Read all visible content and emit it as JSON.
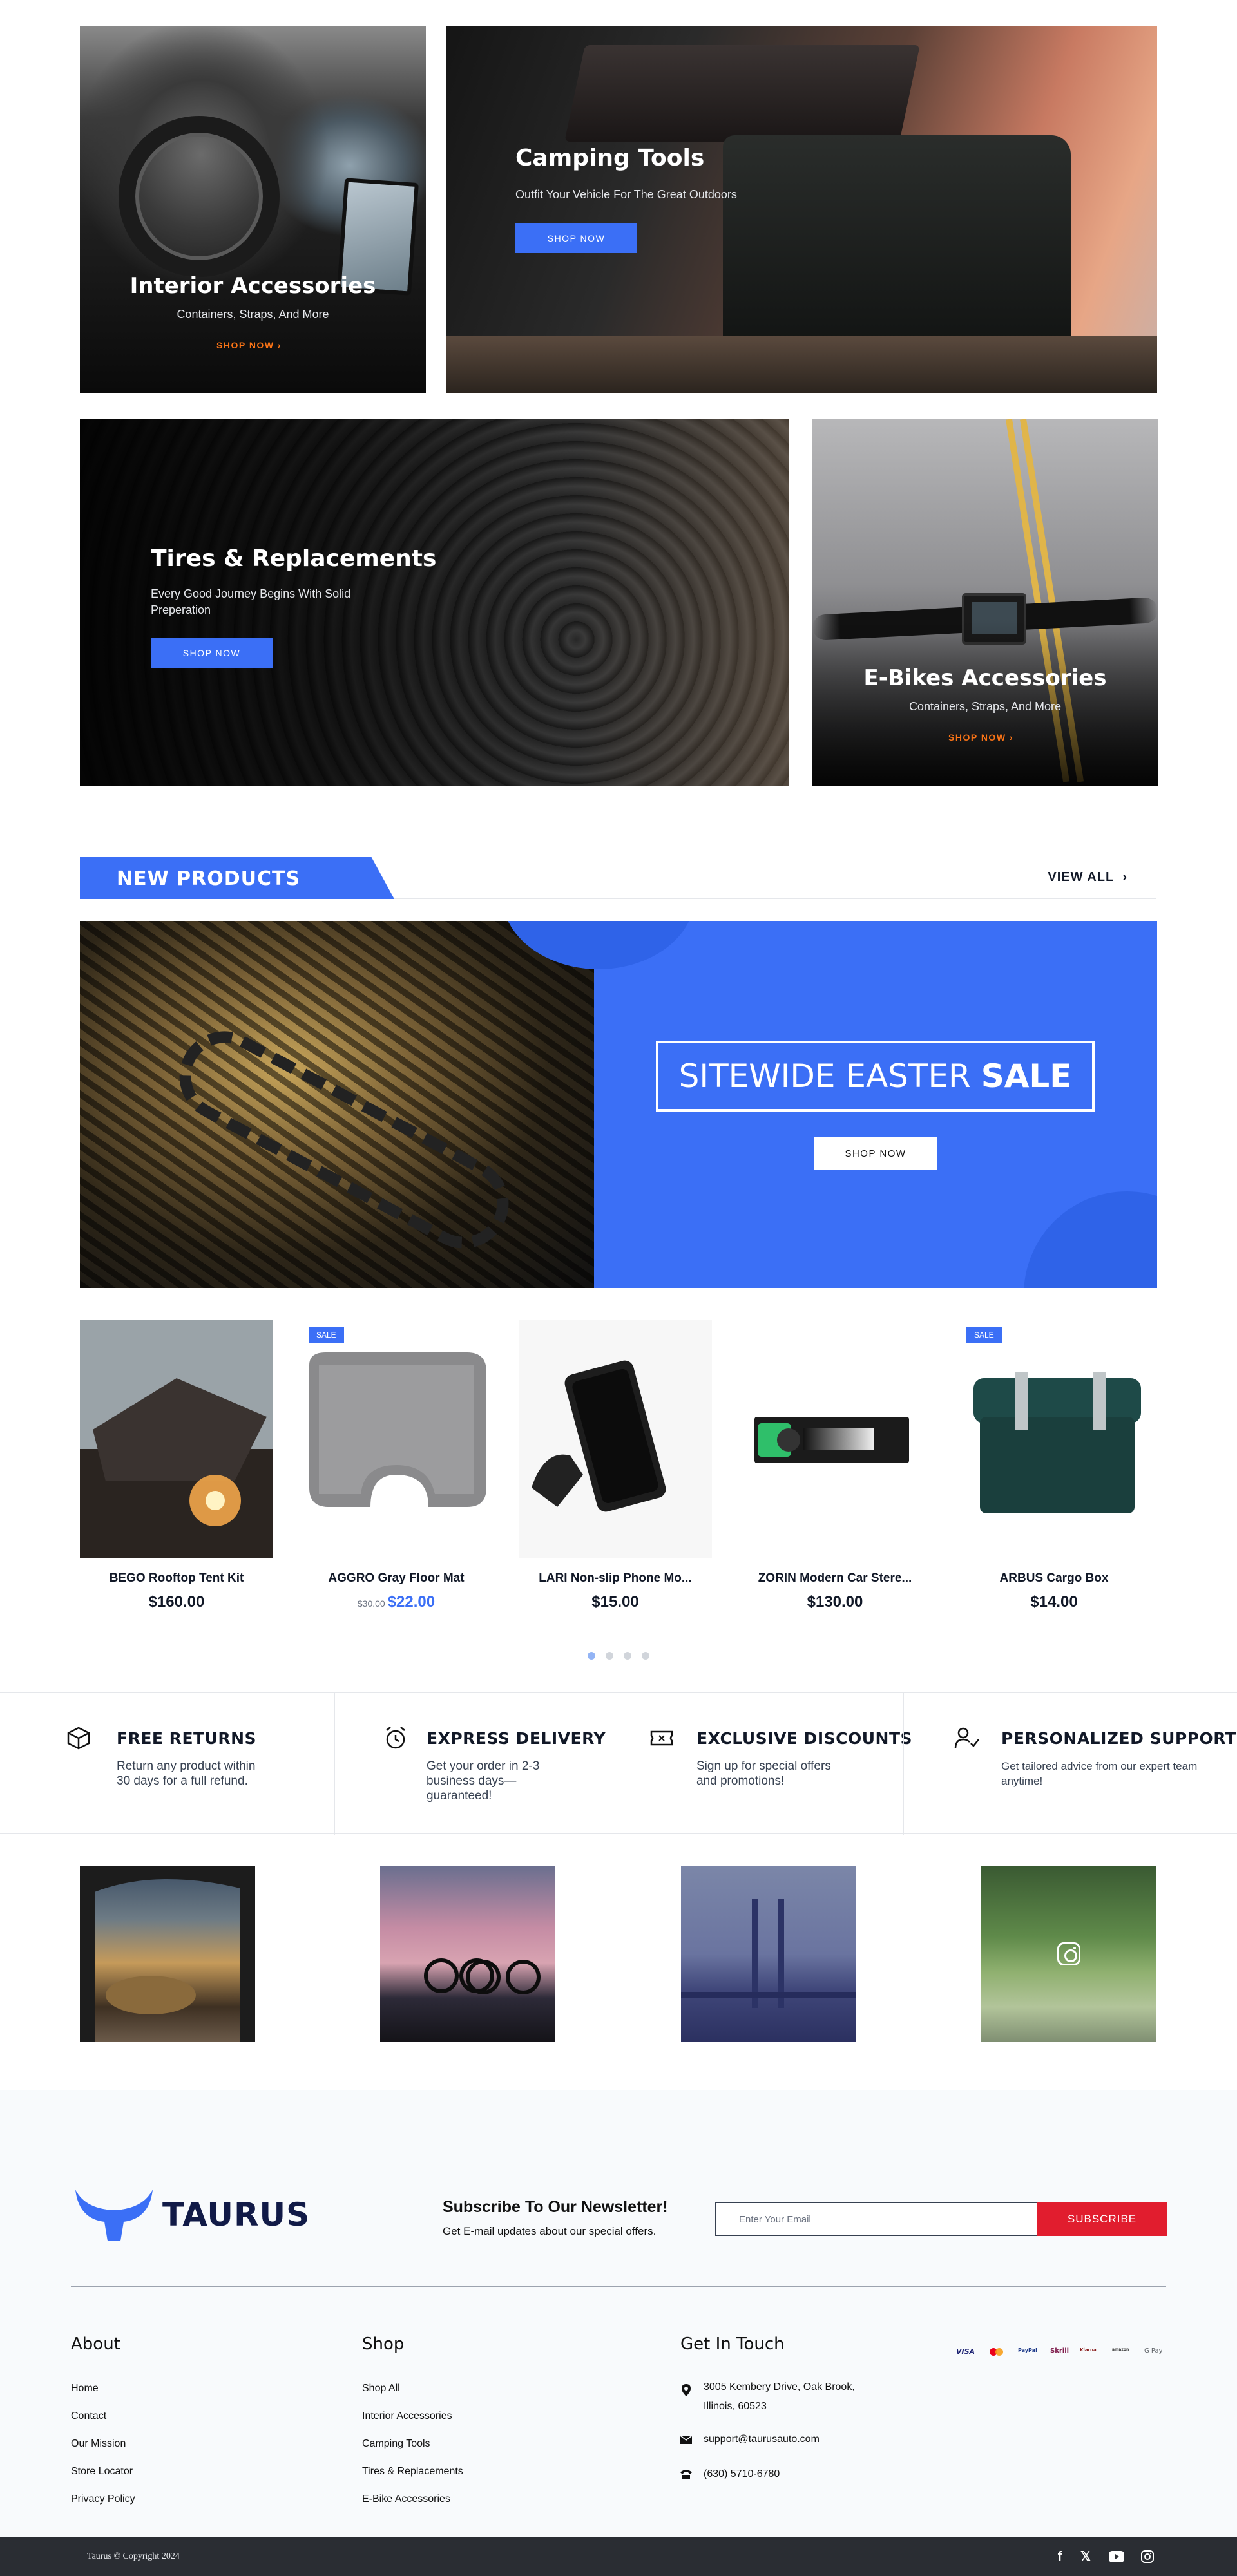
{
  "banners": {
    "interior": {
      "title": "Interior Accessories",
      "subtitle": "Containers, Straps, And More",
      "cta": "SHOP NOW"
    },
    "camping": {
      "title": "Camping Tools",
      "subtitle": "Outfit Your Vehicle For The Great Outdoors",
      "cta": "SHOP NOW"
    },
    "tires": {
      "title": "Tires & Replacements",
      "subtitle_line1": "Every Good Journey Begins With Solid",
      "subtitle_line2": "Preperation",
      "cta": "SHOP NOW"
    },
    "ebikes": {
      "title": "E-Bikes Accessories",
      "subtitle": "Containers, Straps, And More",
      "cta": "SHOP NOW"
    }
  },
  "new_products": {
    "title": "NEW PRODUCTS",
    "view_all": "VIEW ALL"
  },
  "sale_banner": {
    "text_regular": "SITEWIDE EASTER",
    "text_bold": "SALE",
    "cta": "SHOP NOW"
  },
  "products": [
    {
      "name": "BEGO Rooftop Tent Kit",
      "price": "$160.00",
      "on_sale": false
    },
    {
      "name": "AGGRO Gray Floor Mat",
      "old_price": "$30.00",
      "price": "$22.00",
      "on_sale": true,
      "badge": "SALE"
    },
    {
      "name": "LARI Non-slip Phone Mo...",
      "price": "$15.00",
      "on_sale": false
    },
    {
      "name": "ZORIN Modern Car Stere...",
      "price": "$130.00",
      "on_sale": false
    },
    {
      "name": "ARBUS Cargo Box",
      "price": "$14.00",
      "on_sale": true,
      "badge": "SALE"
    }
  ],
  "carousel": {
    "pages": 4,
    "active": 1
  },
  "features": [
    {
      "icon": "box-icon",
      "title": "FREE RETURNS",
      "desc_line1": "Return any product within",
      "desc_line2": "30 days for a full refund.",
      "desc_line3": ""
    },
    {
      "icon": "alarm-clock-icon",
      "title": "EXPRESS DELIVERY",
      "desc_line1": "Get your order in 2-3",
      "desc_line2": "business days—",
      "desc_line3": "guaranteed!"
    },
    {
      "icon": "ticket-icon",
      "title": "EXCLUSIVE DISCOUNTS",
      "desc_line1": "Sign up for special offers",
      "desc_line2": "and promotions!",
      "desc_line3": ""
    },
    {
      "icon": "user-check-icon",
      "title": "PERSONALIZED SUPPORT",
      "desc_line1": "Get tailored advice from our expert team",
      "desc_line2": "anytime!",
      "desc_line3": ""
    }
  ],
  "footer": {
    "brand": "TAURUS",
    "newsletter": {
      "title": "Subscribe To Our Newsletter!",
      "subtitle": "Get E-mail updates about our special offers.",
      "placeholder": "Enter Your Email",
      "button": "SUBSCRIBE"
    },
    "about": {
      "title": "About",
      "links": [
        "Home",
        "Contact",
        "Our Mission",
        "Store Locator",
        "Privacy Policy"
      ]
    },
    "shop": {
      "title": "Shop",
      "links": [
        "Shop All",
        "Interior Accessories",
        "Camping Tools",
        "Tires & Replacements",
        "E-Bike Accessories"
      ]
    },
    "contact": {
      "title": "Get In Touch",
      "address_line1": "3005 Kembery Drive, Oak Brook,",
      "address_line2": "Illinois, 60523",
      "email": "support@taurusauto.com",
      "phone": "(630) 5710-6780"
    },
    "payments": [
      "VISA",
      "Mastercard",
      "PayPal",
      "Skrill",
      "Klarna",
      "Amazon Pay",
      "G Pay"
    ],
    "copyright": "Taurus © Copyright 2024",
    "social": [
      "facebook-icon",
      "x-icon",
      "youtube-icon",
      "instagram-icon"
    ]
  },
  "colors": {
    "primary": "#3b6ff6",
    "accent_orange": "#f97316",
    "subscribe_red": "#e11d2e",
    "navy": "#111a47",
    "dark_bar": "#2a2d33"
  }
}
